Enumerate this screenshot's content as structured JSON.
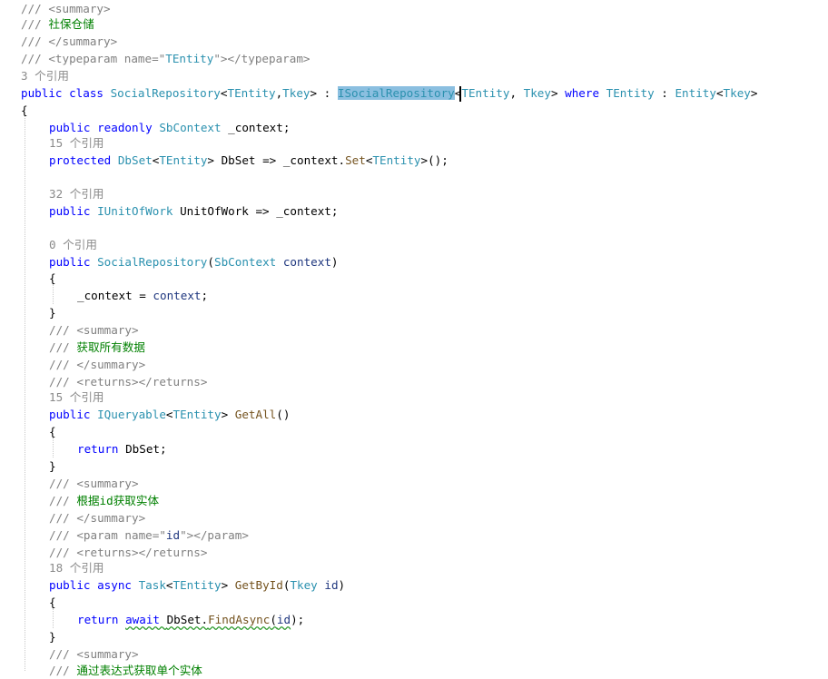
{
  "editor": {
    "language": "C#",
    "colors": {
      "background": "#ffffff",
      "comment_green": "#008000",
      "doc_gray": "#808080",
      "keyword_blue": "#0000ff",
      "type_teal": "#2b91af",
      "codelens_gray": "#8a8a8a",
      "selection_highlight": "#8bbfe0",
      "squiggle_green": "#2e9b2e"
    },
    "lines": [
      {
        "indent": 0,
        "tokens": [
          {
            "t": "/// ",
            "c": "dg"
          },
          {
            "t": "<summary>",
            "c": "dc"
          }
        ]
      },
      {
        "indent": 0,
        "tokens": [
          {
            "t": "/// ",
            "c": "dg"
          },
          {
            "t": "社保仓储",
            "c": "cm"
          }
        ]
      },
      {
        "indent": 0,
        "tokens": [
          {
            "t": "/// ",
            "c": "dg"
          },
          {
            "t": "</summary>",
            "c": "dc"
          }
        ]
      },
      {
        "indent": 0,
        "tokens": [
          {
            "t": "/// ",
            "c": "dg"
          },
          {
            "t": "<typeparam name=\"",
            "c": "dc"
          },
          {
            "t": "TEntity",
            "c": "ty"
          },
          {
            "t": "\"></typeparam>",
            "c": "dc"
          }
        ]
      },
      {
        "codelens": "3 个引用",
        "indent": 0
      },
      {
        "indent": 0,
        "tokens": [
          {
            "t": "public class ",
            "c": "kw"
          },
          {
            "t": "SocialRepository",
            "c": "ty"
          },
          {
            "t": "<",
            "c": "id"
          },
          {
            "t": "TEntity",
            "c": "ty"
          },
          {
            "t": ",",
            "c": "id"
          },
          {
            "t": "Tkey",
            "c": "ty"
          },
          {
            "t": "> : ",
            "c": "id"
          },
          {
            "t": "ISocialRepository",
            "c": "hl"
          },
          {
            "t": "<",
            "c": "id"
          },
          {
            "t": "TEntity",
            "c": "ty"
          },
          {
            "t": ", ",
            "c": "id"
          },
          {
            "t": "Tkey",
            "c": "ty"
          },
          {
            "t": "> ",
            "c": "id"
          },
          {
            "t": "where ",
            "c": "kw"
          },
          {
            "t": "TEntity",
            "c": "ty"
          },
          {
            "t": " : ",
            "c": "id"
          },
          {
            "t": "Entity",
            "c": "ty"
          },
          {
            "t": "<",
            "c": "id"
          },
          {
            "t": "Tkey",
            "c": "ty"
          },
          {
            "t": ">",
            "c": "id"
          }
        ]
      },
      {
        "indent": 0,
        "tokens": [
          {
            "t": "{",
            "c": "id"
          }
        ]
      },
      {
        "indent": 1,
        "tokens": [
          {
            "t": "public readonly ",
            "c": "kw"
          },
          {
            "t": "SbContext",
            "c": "ty"
          },
          {
            "t": " _context;",
            "c": "id"
          }
        ]
      },
      {
        "codelens": "15 个引用",
        "indent": 1
      },
      {
        "indent": 1,
        "tokens": [
          {
            "t": "protected ",
            "c": "kw"
          },
          {
            "t": "DbSet",
            "c": "ty"
          },
          {
            "t": "<",
            "c": "id"
          },
          {
            "t": "TEntity",
            "c": "ty"
          },
          {
            "t": "> DbSet => _context.",
            "c": "id"
          },
          {
            "t": "Set",
            "c": "me"
          },
          {
            "t": "<",
            "c": "id"
          },
          {
            "t": "TEntity",
            "c": "ty"
          },
          {
            "t": ">();",
            "c": "id"
          }
        ]
      },
      {
        "blank": true
      },
      {
        "codelens": "32 个引用",
        "indent": 1
      },
      {
        "indent": 1,
        "tokens": [
          {
            "t": "public ",
            "c": "kw"
          },
          {
            "t": "IUnitOfWork",
            "c": "ty"
          },
          {
            "t": " UnitOfWork => _context;",
            "c": "id"
          }
        ]
      },
      {
        "blank": true
      },
      {
        "codelens": "0 个引用",
        "indent": 1
      },
      {
        "indent": 1,
        "tokens": [
          {
            "t": "public ",
            "c": "kw"
          },
          {
            "t": "SocialRepository",
            "c": "ty"
          },
          {
            "t": "(",
            "c": "id"
          },
          {
            "t": "SbContext",
            "c": "ty"
          },
          {
            "t": " ",
            "c": "id"
          },
          {
            "t": "context",
            "c": "pa"
          },
          {
            "t": ")",
            "c": "id"
          }
        ]
      },
      {
        "indent": 1,
        "tokens": [
          {
            "t": "{",
            "c": "id"
          }
        ]
      },
      {
        "indent": 2,
        "tokens": [
          {
            "t": "_context = ",
            "c": "id"
          },
          {
            "t": "context",
            "c": "pa"
          },
          {
            "t": ";",
            "c": "id"
          }
        ]
      },
      {
        "indent": 1,
        "tokens": [
          {
            "t": "}",
            "c": "id"
          }
        ]
      },
      {
        "indent": 1,
        "tokens": [
          {
            "t": "/// ",
            "c": "dg"
          },
          {
            "t": "<summary>",
            "c": "dc"
          }
        ]
      },
      {
        "indent": 1,
        "tokens": [
          {
            "t": "/// ",
            "c": "dg"
          },
          {
            "t": "获取所有数据",
            "c": "cm"
          }
        ]
      },
      {
        "indent": 1,
        "tokens": [
          {
            "t": "/// ",
            "c": "dg"
          },
          {
            "t": "</summary>",
            "c": "dc"
          }
        ]
      },
      {
        "indent": 1,
        "tokens": [
          {
            "t": "/// ",
            "c": "dg"
          },
          {
            "t": "<returns></returns>",
            "c": "dc"
          }
        ]
      },
      {
        "codelens": "15 个引用",
        "indent": 1
      },
      {
        "indent": 1,
        "tokens": [
          {
            "t": "public ",
            "c": "kw"
          },
          {
            "t": "IQueryable",
            "c": "ty"
          },
          {
            "t": "<",
            "c": "id"
          },
          {
            "t": "TEntity",
            "c": "ty"
          },
          {
            "t": "> ",
            "c": "id"
          },
          {
            "t": "GetAll",
            "c": "me"
          },
          {
            "t": "()",
            "c": "id"
          }
        ]
      },
      {
        "indent": 1,
        "tokens": [
          {
            "t": "{",
            "c": "id"
          }
        ]
      },
      {
        "indent": 2,
        "tokens": [
          {
            "t": "return ",
            "c": "kw"
          },
          {
            "t": "DbSet;",
            "c": "id"
          }
        ]
      },
      {
        "indent": 1,
        "tokens": [
          {
            "t": "}",
            "c": "id"
          }
        ]
      },
      {
        "indent": 1,
        "tokens": [
          {
            "t": "/// ",
            "c": "dg"
          },
          {
            "t": "<summary>",
            "c": "dc"
          }
        ]
      },
      {
        "indent": 1,
        "tokens": [
          {
            "t": "/// ",
            "c": "dg"
          },
          {
            "t": "根据id获取实体",
            "c": "cm"
          }
        ]
      },
      {
        "indent": 1,
        "tokens": [
          {
            "t": "/// ",
            "c": "dg"
          },
          {
            "t": "</summary>",
            "c": "dc"
          }
        ]
      },
      {
        "indent": 1,
        "tokens": [
          {
            "t": "/// ",
            "c": "dg"
          },
          {
            "t": "<param name=\"",
            "c": "dc"
          },
          {
            "t": "id",
            "c": "pa"
          },
          {
            "t": "\"></param>",
            "c": "dc"
          }
        ]
      },
      {
        "indent": 1,
        "tokens": [
          {
            "t": "/// ",
            "c": "dg"
          },
          {
            "t": "<returns></returns>",
            "c": "dc"
          }
        ]
      },
      {
        "codelens": "18 个引用",
        "indent": 1
      },
      {
        "indent": 1,
        "tokens": [
          {
            "t": "public async ",
            "c": "kw"
          },
          {
            "t": "Task",
            "c": "ty"
          },
          {
            "t": "<",
            "c": "id"
          },
          {
            "t": "TEntity",
            "c": "ty"
          },
          {
            "t": "> ",
            "c": "id"
          },
          {
            "t": "GetById",
            "c": "me"
          },
          {
            "t": "(",
            "c": "id"
          },
          {
            "t": "Tkey",
            "c": "ty"
          },
          {
            "t": " ",
            "c": "id"
          },
          {
            "t": "id",
            "c": "pa"
          },
          {
            "t": ")",
            "c": "id"
          }
        ]
      },
      {
        "indent": 1,
        "tokens": [
          {
            "t": "{",
            "c": "id"
          }
        ]
      },
      {
        "indent": 2,
        "tokens": [
          {
            "t": "return ",
            "c": "kw"
          },
          {
            "t": "await ",
            "c": "kw",
            "err": true
          },
          {
            "t": "DbSet.",
            "c": "id",
            "err": true
          },
          {
            "t": "FindAsync",
            "c": "me",
            "err": true
          },
          {
            "t": "(",
            "c": "id",
            "err": true
          },
          {
            "t": "id",
            "c": "pa",
            "err": true
          },
          {
            "t": ");",
            "c": "id"
          }
        ]
      },
      {
        "indent": 1,
        "tokens": [
          {
            "t": "}",
            "c": "id"
          }
        ]
      },
      {
        "indent": 1,
        "tokens": [
          {
            "t": "/// ",
            "c": "dg"
          },
          {
            "t": "<summary>",
            "c": "dc"
          }
        ]
      },
      {
        "indent": 1,
        "tokens": [
          {
            "t": "/// ",
            "c": "dg"
          },
          {
            "t": "通过表达式获取单个实体",
            "c": "cm"
          }
        ]
      }
    ]
  }
}
